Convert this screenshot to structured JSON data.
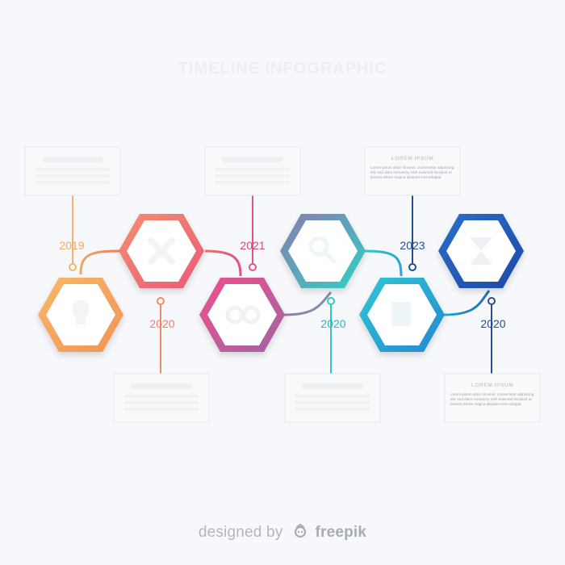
{
  "header": {
    "title": "TIMELINE INFOGRAPHIC"
  },
  "steps": [
    {
      "year": "2019",
      "icon": "lightbulb-icon",
      "heading": "",
      "body": ""
    },
    {
      "year": "2020",
      "icon": "cross-icon",
      "heading": "",
      "body": ""
    },
    {
      "year": "2021",
      "icon": "gears-icon",
      "heading": "",
      "body": ""
    },
    {
      "year": "2020",
      "icon": "magnifier-icon",
      "heading": "",
      "body": ""
    },
    {
      "year": "2023",
      "icon": "document-icon",
      "heading": "LOREM IPSUM",
      "body": "Lorem ipsum dolor sit amet, consectetur adipiscing elit, sed diam nonummy nibh euismod tincidunt ut laoreet dolore magna aliquam erat volutpat."
    },
    {
      "year": "2020",
      "icon": "hourglass-icon",
      "heading": "LOREM IPSUM",
      "body": "Lorem ipsum dolor sit amet, consectetur adipiscing elit, sed diam nonummy nibh euismod tincidunt ut laoreet dolore magna aliquam erat volutpat."
    }
  ],
  "colors": {
    "step1": "#f3a65e",
    "step2": "#ee6f6a",
    "step3": "#e44f8a",
    "step4": "#34c9c8",
    "step5": "#22a8d8",
    "step6": "#1f5fb2"
  },
  "footer": {
    "prefix": "designed by",
    "brand": "freepik"
  }
}
